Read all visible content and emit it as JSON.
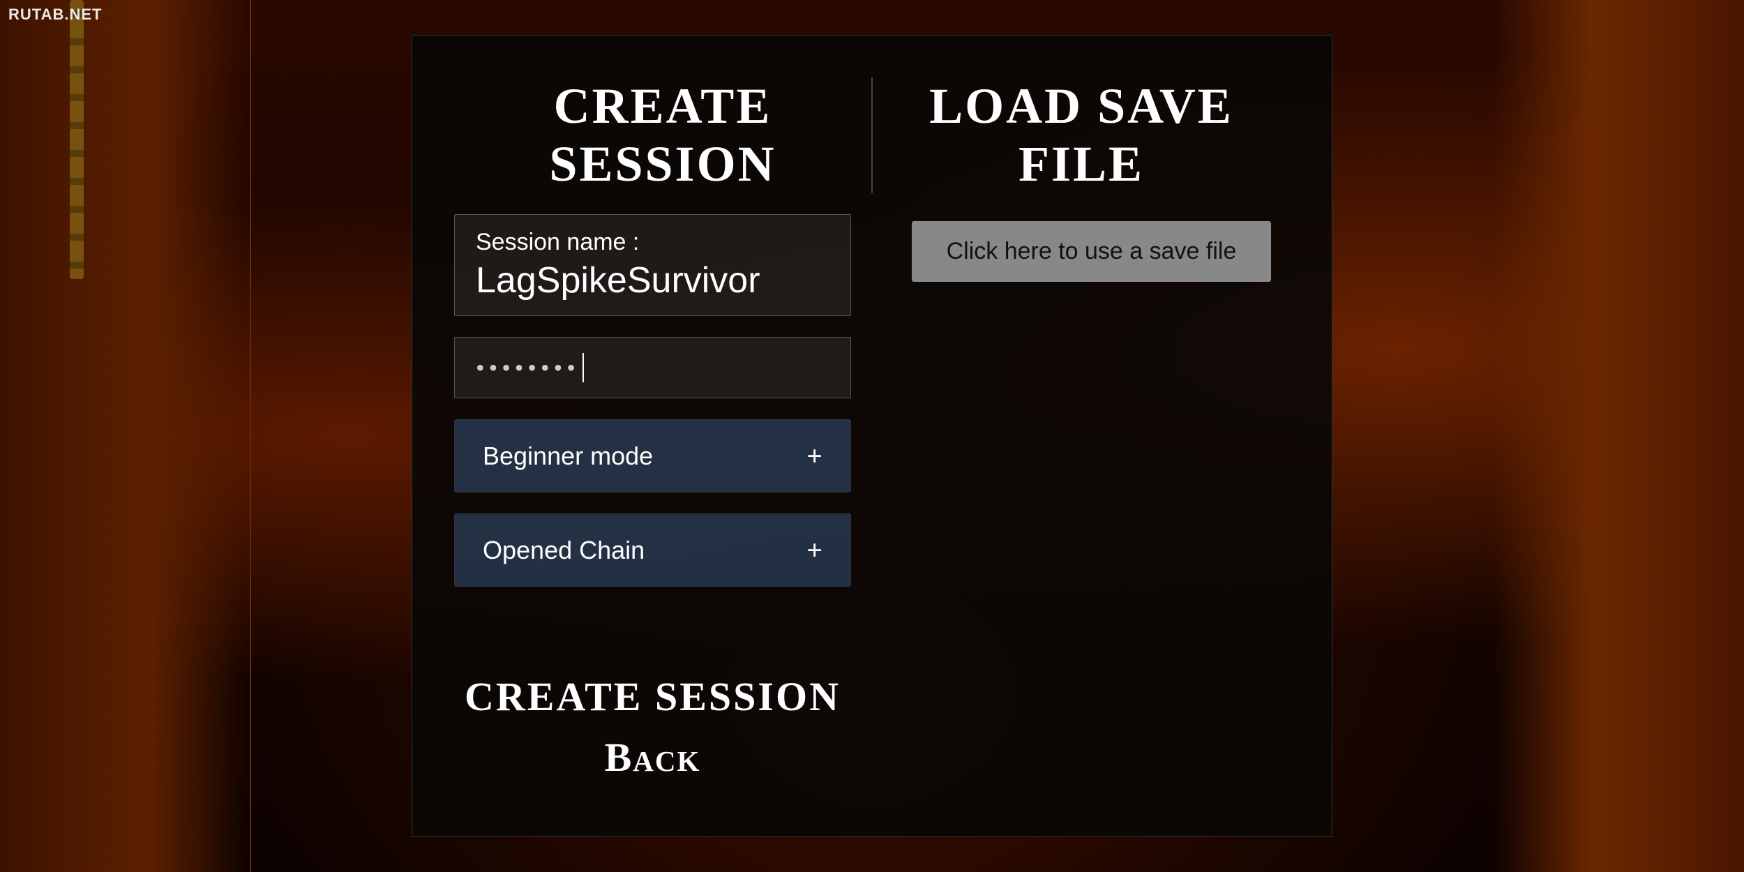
{
  "watermark": {
    "text": "RUTAB.NET"
  },
  "panel": {
    "left_title": "Create Session",
    "right_title": "Load Save File",
    "session_name_label": "Session name :",
    "session_name_value": "LagSpikeSurvivor",
    "password_dots": "••••••••",
    "beginner_mode_label": "Beginner mode",
    "beginner_mode_plus": "+",
    "opened_chain_label": "Opened Chain",
    "opened_chain_plus": "+",
    "create_session_btn": "Create Session",
    "back_btn": "Back",
    "load_save_btn": "Click here to use a save file"
  }
}
